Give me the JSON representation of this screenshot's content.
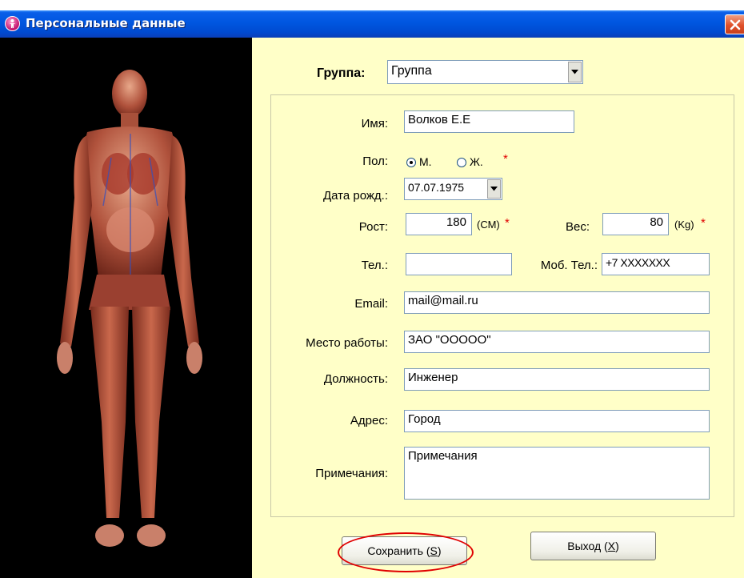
{
  "window": {
    "title": "Персональные данные"
  },
  "form": {
    "group": {
      "label": "Группа:",
      "value": "Группа"
    },
    "name": {
      "label": "Имя:",
      "value": "Волков Е.Е"
    },
    "sex": {
      "label": "Пол:",
      "option_male": "М.",
      "option_female": "Ж.",
      "selected": "М.",
      "required_mark": "*"
    },
    "birthdate": {
      "label": "Дата рожд.:",
      "value": "07.07.1975"
    },
    "height": {
      "label": "Рост:",
      "value": "180",
      "unit": "(СМ)",
      "required_mark": "*"
    },
    "weight": {
      "label": "Вес:",
      "value": "80",
      "unit": "(Kg)",
      "required_mark": "*"
    },
    "phone": {
      "label": "Тел.:",
      "value": ""
    },
    "mobile": {
      "label": "Моб. Тел.:",
      "value": "+7 XXXXXXX"
    },
    "email": {
      "label": "Email:",
      "value": "mail@mail.ru"
    },
    "workplace": {
      "label": "Место работы:",
      "value": "ЗАО \"ООООО\""
    },
    "position": {
      "label": "Должность:",
      "value": "Инженер"
    },
    "address": {
      "label": "Адрес:",
      "value": "Город"
    },
    "notes": {
      "label": "Примечания:",
      "value": "Примечания"
    }
  },
  "buttons": {
    "save": {
      "text": "Сохранить (",
      "hotkey": "S",
      "suffix": ")"
    },
    "exit": {
      "text": "Выход (",
      "hotkey": "X",
      "suffix": ")"
    }
  },
  "colors": {
    "form_background": "#ffffc8",
    "titlebar": "#0054e3",
    "highlight": "#e00000",
    "required": "#e00000"
  },
  "icons": {
    "app": "person-circle-icon",
    "close": "close-icon",
    "dropdown": "chevron-down-icon",
    "image": "human-anatomy-illustration"
  }
}
